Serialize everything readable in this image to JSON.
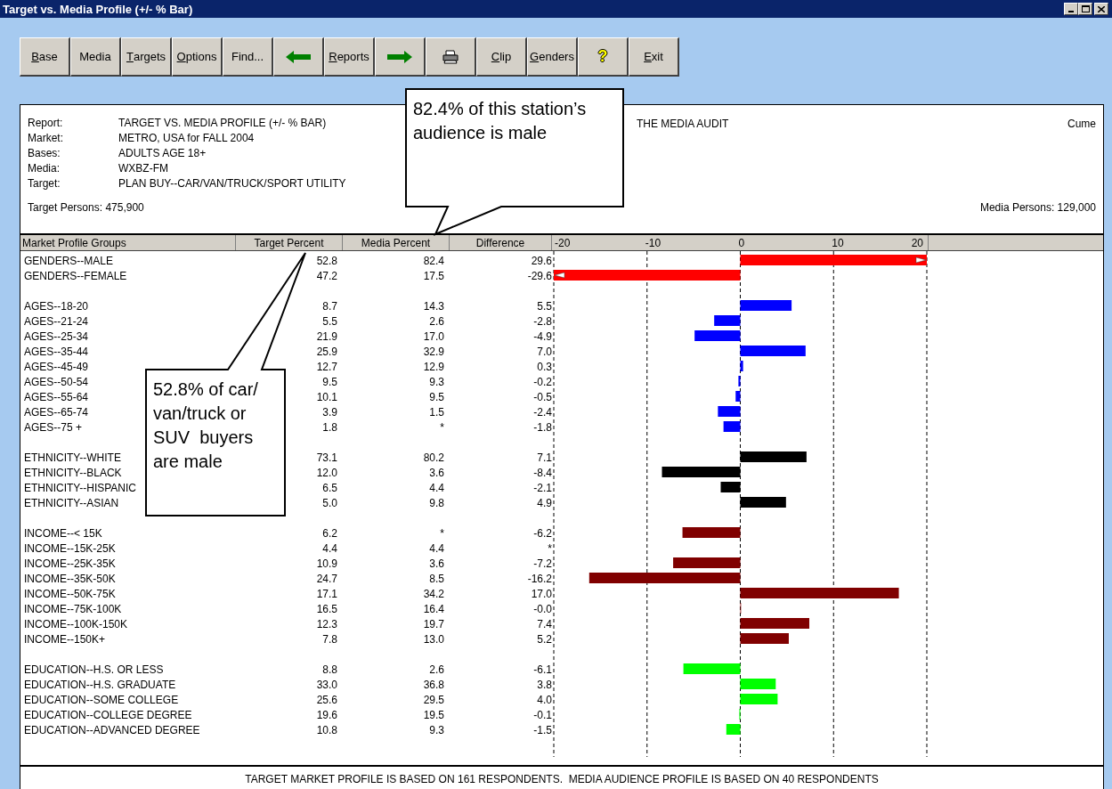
{
  "window": {
    "title": "Target vs. Media Profile (+/- % Bar)"
  },
  "toolbar": {
    "buttons": [
      {
        "kind": "text",
        "mnemonic": "B",
        "label": "ase"
      },
      {
        "kind": "text",
        "label": "Media"
      },
      {
        "kind": "text",
        "mnemonic": "T",
        "label": "argets"
      },
      {
        "kind": "text",
        "mnemonic": "O",
        "label": "ptions"
      },
      {
        "kind": "text",
        "label": "Find..."
      },
      {
        "kind": "back"
      },
      {
        "kind": "text",
        "mnemonic": "R",
        "label": "eports"
      },
      {
        "kind": "forward"
      },
      {
        "kind": "print"
      },
      {
        "kind": "text",
        "mnemonic": "C",
        "label": "lip"
      },
      {
        "kind": "text",
        "mnemonic": "G",
        "label": "enders"
      },
      {
        "kind": "help",
        "label": "?"
      },
      {
        "kind": "text",
        "mnemonic": "E",
        "label": "xit"
      }
    ]
  },
  "report_header": {
    "fields": [
      {
        "label": "Report:",
        "value": "TARGET VS. MEDIA PROFILE (+/- % BAR)"
      },
      {
        "label": "Market:",
        "value": "METRO, USA for FALL 2004"
      },
      {
        "label": "Bases:",
        "value": "ADULTS AGE 18+"
      },
      {
        "label": "Media:",
        "value": "WXBZ-FM"
      },
      {
        "label": "Target:",
        "value": "PLAN BUY--CAR/VAN/TRUCK/SPORT UTILITY"
      }
    ],
    "target_persons": "Target Persons: 475,900",
    "source": "THE MEDIA AUDIT",
    "measure": "Cume",
    "media_persons": "Media Persons: 129,000"
  },
  "table": {
    "columns": [
      "Market Profile Groups",
      "Target Percent",
      "Media Percent",
      "Difference"
    ],
    "axis_ticks": [
      "-20",
      "-10",
      "0",
      "10",
      "20"
    ],
    "groups": [
      {
        "color": "#ff0000",
        "rows": [
          {
            "label": "GENDERS--MALE",
            "target": "52.8",
            "media": "82.4",
            "difference": "29.6"
          },
          {
            "label": "GENDERS--FEMALE",
            "target": "47.2",
            "media": "17.5",
            "difference": "-29.6"
          }
        ]
      },
      {
        "color": "#0000ff",
        "rows": [
          {
            "label": "AGES--18-20",
            "target": "8.7",
            "media": "14.3",
            "difference": "5.5"
          },
          {
            "label": "AGES--21-24",
            "target": "5.5",
            "media": "2.6",
            "difference": "-2.8"
          },
          {
            "label": "AGES--25-34",
            "target": "21.9",
            "media": "17.0",
            "difference": "-4.9"
          },
          {
            "label": "AGES--35-44",
            "target": "25.9",
            "media": "32.9",
            "difference": "7.0"
          },
          {
            "label": "AGES--45-49",
            "target": "12.7",
            "media": "12.9",
            "difference": "0.3"
          },
          {
            "label": "AGES--50-54",
            "target": "9.5",
            "media": "9.3",
            "difference": "-0.2"
          },
          {
            "label": "AGES--55-64",
            "target": "10.1",
            "media": "9.5",
            "difference": "-0.5"
          },
          {
            "label": "AGES--65-74",
            "target": "3.9",
            "media": "1.5",
            "difference": "-2.4"
          },
          {
            "label": "AGES--75 +",
            "target": "1.8",
            "media": "*",
            "difference": "-1.8"
          }
        ]
      },
      {
        "color": "#000000",
        "rows": [
          {
            "label": "ETHNICITY--WHITE",
            "target": "73.1",
            "media": "80.2",
            "difference": "7.1"
          },
          {
            "label": "ETHNICITY--BLACK",
            "target": "12.0",
            "media": "3.6",
            "difference": "-8.4"
          },
          {
            "label": "ETHNICITY--HISPANIC",
            "target": "6.5",
            "media": "4.4",
            "difference": "-2.1"
          },
          {
            "label": "ETHNICITY--ASIAN",
            "target": "5.0",
            "media": "9.8",
            "difference": "4.9"
          }
        ]
      },
      {
        "color": "#800000",
        "rows": [
          {
            "label": "INCOME--< 15K",
            "target": "6.2",
            "media": "*",
            "difference": "-6.2"
          },
          {
            "label": "INCOME--15K-25K",
            "target": "4.4",
            "media": "4.4",
            "difference": "*"
          },
          {
            "label": "INCOME--25K-35K",
            "target": "10.9",
            "media": "3.6",
            "difference": "-7.2"
          },
          {
            "label": "INCOME--35K-50K",
            "target": "24.7",
            "media": "8.5",
            "difference": "-16.2"
          },
          {
            "label": "INCOME--50K-75K",
            "target": "17.1",
            "media": "34.2",
            "difference": "17.0"
          },
          {
            "label": "INCOME--75K-100K",
            "target": "16.5",
            "media": "16.4",
            "difference": "-0.0"
          },
          {
            "label": "INCOME--100K-150K",
            "target": "12.3",
            "media": "19.7",
            "difference": "7.4"
          },
          {
            "label": "INCOME--150K+",
            "target": "7.8",
            "media": "13.0",
            "difference": "5.2"
          }
        ]
      },
      {
        "color": "#00ff00",
        "rows": [
          {
            "label": "EDUCATION--H.S. OR LESS",
            "target": "8.8",
            "media": "2.6",
            "difference": "-6.1"
          },
          {
            "label": "EDUCATION--H.S. GRADUATE",
            "target": "33.0",
            "media": "36.8",
            "difference": "3.8"
          },
          {
            "label": "EDUCATION--SOME COLLEGE",
            "target": "25.6",
            "media": "29.5",
            "difference": "4.0"
          },
          {
            "label": "EDUCATION--COLLEGE DEGREE",
            "target": "19.6",
            "media": "19.5",
            "difference": "-0.1"
          },
          {
            "label": "EDUCATION--ADVANCED DEGREE",
            "target": "10.8",
            "media": "9.3",
            "difference": "-1.5"
          }
        ]
      }
    ]
  },
  "footer": "TARGET MARKET PROFILE IS BASED ON 161 RESPONDENTS.  MEDIA AUDIENCE PROFILE IS BASED ON 40 RESPONDENTS",
  "callouts": [
    {
      "text": "82.4% of this station’s audience is male"
    },
    {
      "text": "52.8% of car/\nvan/truck or\nSUV  buyers\nare male"
    }
  ]
}
